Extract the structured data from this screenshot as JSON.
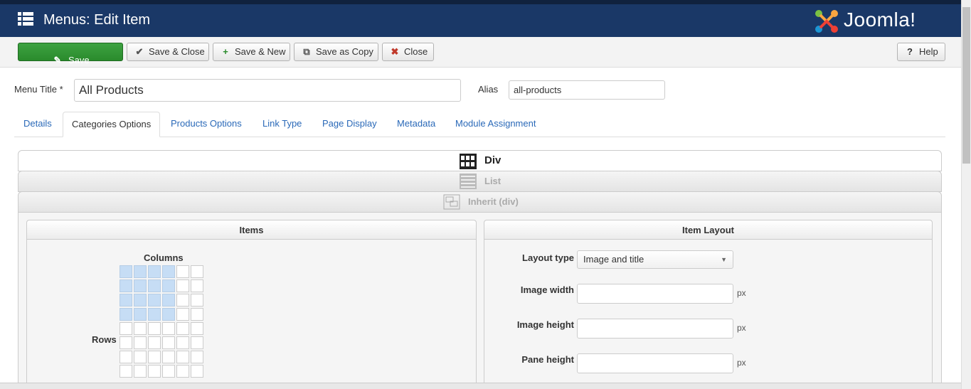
{
  "header": {
    "title": "Menus: Edit Item",
    "logo_text": "Joomla!"
  },
  "toolbar": {
    "save": "Save",
    "save_close": "Save & Close",
    "save_new": "Save & New",
    "save_copy": "Save as Copy",
    "close": "Close",
    "help": "Help"
  },
  "form": {
    "menu_title_label": "Menu Title *",
    "menu_title_value": "All Products",
    "alias_label": "Alias",
    "alias_value": "all-products"
  },
  "tabs": [
    "Details",
    "Categories Options",
    "Products Options",
    "Link Type",
    "Page Display",
    "Metadata",
    "Module Assignment"
  ],
  "active_tab": "Categories Options",
  "layout_options": {
    "div": "Div",
    "list": "List",
    "inherit": "Inherit (div)"
  },
  "items_panel": {
    "title": "Items",
    "columns_label": "Columns",
    "rows_label": "Rows",
    "selected_columns": 4,
    "selected_rows": 4
  },
  "item_layout_panel": {
    "title": "Item Layout",
    "layout_type_label": "Layout type",
    "layout_type_value": "Image and title",
    "image_width_label": "Image width",
    "image_height_label": "Image height",
    "pane_height_label": "Pane height",
    "unit": "px"
  },
  "colors": {
    "header_bg": "#1a3867",
    "save_green": "#2a8b2c",
    "link_blue": "#2a69b8",
    "grid_selected": "#c6ddf5"
  }
}
